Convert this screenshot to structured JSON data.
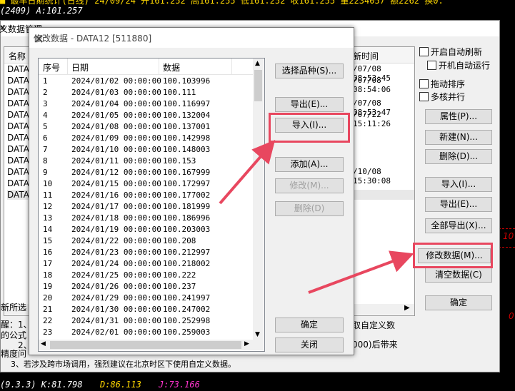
{
  "top": {
    "line1": "■ 最早日期统计(日线) 24/09/24  开161.252  高161.255  低161.252  收161.255  量2234057  额2262  换0.",
    "line2": "(2409) A:101.257"
  },
  "bottom": {
    "p1": "(9.3.3) K:81.798",
    "p2": "D:86.113",
    "p3": "J:73.166"
  },
  "right_axis": {
    "v1": "10",
    "v2": "0"
  },
  "outer": {
    "title": "义数据管理",
    "columns": {
      "name": "名称",
      "time": "新时间"
    },
    "names": [
      "DATA1",
      "DATA2",
      "DATA3",
      "DATA4",
      "DATA5",
      "DATA6",
      "DATA7",
      "DATA8",
      "DATA9",
      "DATA1",
      "DATA1",
      "DATA1"
    ],
    "times": [
      "/07/08 08:53:45",
      "/07/08 08:54:06",
      "",
      "/07/08 08:53:47",
      "/07/22 15:11:26",
      "",
      "",
      "",
      "",
      "/10/08 15:30:08",
      "",
      ""
    ],
    "checkboxes": {
      "auto_refresh": "开启自动刷新",
      "boot_run": "开机自动运行",
      "drag_sort": "拖动排序",
      "multicore": "多核并行"
    },
    "buttons": {
      "attr": "属性(P)...",
      "new": "新建(N)...",
      "delete": "删除(D)...",
      "import": "导入(I)...",
      "export": "导出(E)...",
      "export_all": "全部导出(X)...",
      "modify": "修改数据(M)...",
      "clear": "清空数据(C)",
      "ok": "确定"
    },
    "notes": {
      "new_selected": "新所选",
      "tip_prefix": "醒：1、",
      "tip_formula": "的公式",
      "tip_2": "2、",
      "precision": "精度问",
      "custom_suffix": "取自定义数",
      "suffix2": "000)后带来",
      "line3": "3、若涉及跨市场调用，强烈建议在北京时区下使用自定义数据。"
    }
  },
  "dialog": {
    "title": "修改数据 - DATA12 [511880]",
    "columns": {
      "idx": "序号",
      "date": "日期",
      "value": "数据"
    },
    "rows": [
      [
        "1",
        "2024/01/02 00:00:00",
        "100.103996"
      ],
      [
        "2",
        "2024/01/03 00:00:00",
        "100.111"
      ],
      [
        "3",
        "2024/01/04 00:00:00",
        "100.116997"
      ],
      [
        "4",
        "2024/01/05 00:00:00",
        "100.132004"
      ],
      [
        "5",
        "2024/01/08 00:00:00",
        "100.137001"
      ],
      [
        "6",
        "2024/01/09 00:00:00",
        "100.142998"
      ],
      [
        "7",
        "2024/01/10 00:00:00",
        "100.148003"
      ],
      [
        "8",
        "2024/01/11 00:00:00",
        "100.153"
      ],
      [
        "9",
        "2024/01/12 00:00:00",
        "100.167999"
      ],
      [
        "10",
        "2024/01/15 00:00:00",
        "100.172997"
      ],
      [
        "11",
        "2024/01/16 00:00:00",
        "100.177002"
      ],
      [
        "12",
        "2024/01/17 00:00:00",
        "100.181999"
      ],
      [
        "13",
        "2024/01/18 00:00:00",
        "100.186996"
      ],
      [
        "14",
        "2024/01/19 00:00:00",
        "100.203003"
      ],
      [
        "15",
        "2024/01/22 00:00:00",
        "100.208"
      ],
      [
        "16",
        "2024/01/23 00:00:00",
        "100.212997"
      ],
      [
        "17",
        "2024/01/24 00:00:00",
        "100.218002"
      ],
      [
        "18",
        "2024/01/25 00:00:00",
        "100.222"
      ],
      [
        "19",
        "2024/01/26 00:00:00",
        "100.237"
      ],
      [
        "20",
        "2024/01/29 00:00:00",
        "100.241997"
      ],
      [
        "21",
        "2024/01/30 00:00:00",
        "100.247002"
      ],
      [
        "22",
        "2024/01/31 00:00:00",
        "100.252998"
      ],
      [
        "23",
        "2024/02/01 00:00:00",
        "100.259003"
      ]
    ],
    "buttons": {
      "select": "选择品种(S)...",
      "export": "导出(E)...",
      "import": "导入(I)...",
      "add": "添加(A)...",
      "modify": "修改(M)...",
      "delete": "删除(D)",
      "ok": "确定",
      "close": "关闭"
    }
  },
  "colors": {
    "highlight": "#e8475f",
    "yellow": "#ffd800",
    "magenta": "#ff33cc"
  }
}
